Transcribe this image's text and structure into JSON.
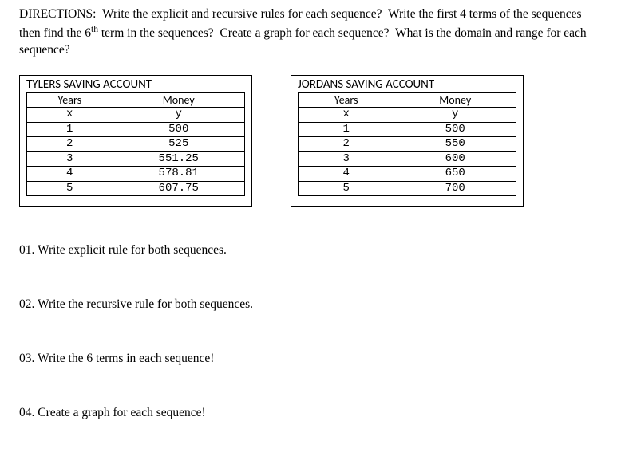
{
  "directions": {
    "label": "DIRECTIONS:",
    "text": "Write the explicit and recursive rules for each sequence?  Write the first 4 terms of the sequences then find the 6th term in the sequences?  Create a graph for each sequence?  What is the domain and range for each sequence?"
  },
  "tables": {
    "left": {
      "title": "TYLERS SAVING ACCOUNT",
      "col1_header": "Years",
      "col2_header": "Money",
      "col1_sub": "x",
      "col2_sub": "y",
      "rows": [
        {
          "x": "1",
          "y": "500"
        },
        {
          "x": "2",
          "y": "525"
        },
        {
          "x": "3",
          "y": "551.25"
        },
        {
          "x": "4",
          "y": "578.81"
        },
        {
          "x": "5",
          "y": "607.75"
        }
      ]
    },
    "right": {
      "title": "JORDANS SAVING ACCOUNT",
      "col1_header": "Years",
      "col2_header": "Money",
      "col1_sub": "x",
      "col2_sub": "y",
      "rows": [
        {
          "x": "1",
          "y": "500"
        },
        {
          "x": "2",
          "y": "550"
        },
        {
          "x": "3",
          "y": "600"
        },
        {
          "x": "4",
          "y": "650"
        },
        {
          "x": "5",
          "y": "700"
        }
      ]
    }
  },
  "questions": {
    "q1": "01.  Write explicit rule for both sequences.",
    "q2": "02.  Write the recursive rule for both sequences.",
    "q3": "03.  Write the 6 terms in each sequence!",
    "q4": "04.  Create a graph for each sequence!"
  },
  "chart_data": [
    {
      "type": "table",
      "title": "TYLERS SAVING ACCOUNT",
      "columns": [
        "Years (x)",
        "Money (y)"
      ],
      "rows": [
        [
          1,
          500
        ],
        [
          2,
          525
        ],
        [
          3,
          551.25
        ],
        [
          4,
          578.81
        ],
        [
          5,
          607.75
        ]
      ]
    },
    {
      "type": "table",
      "title": "JORDANS SAVING ACCOUNT",
      "columns": [
        "Years (x)",
        "Money (y)"
      ],
      "rows": [
        [
          1,
          500
        ],
        [
          2,
          550
        ],
        [
          3,
          600
        ],
        [
          4,
          650
        ],
        [
          5,
          700
        ]
      ]
    }
  ]
}
